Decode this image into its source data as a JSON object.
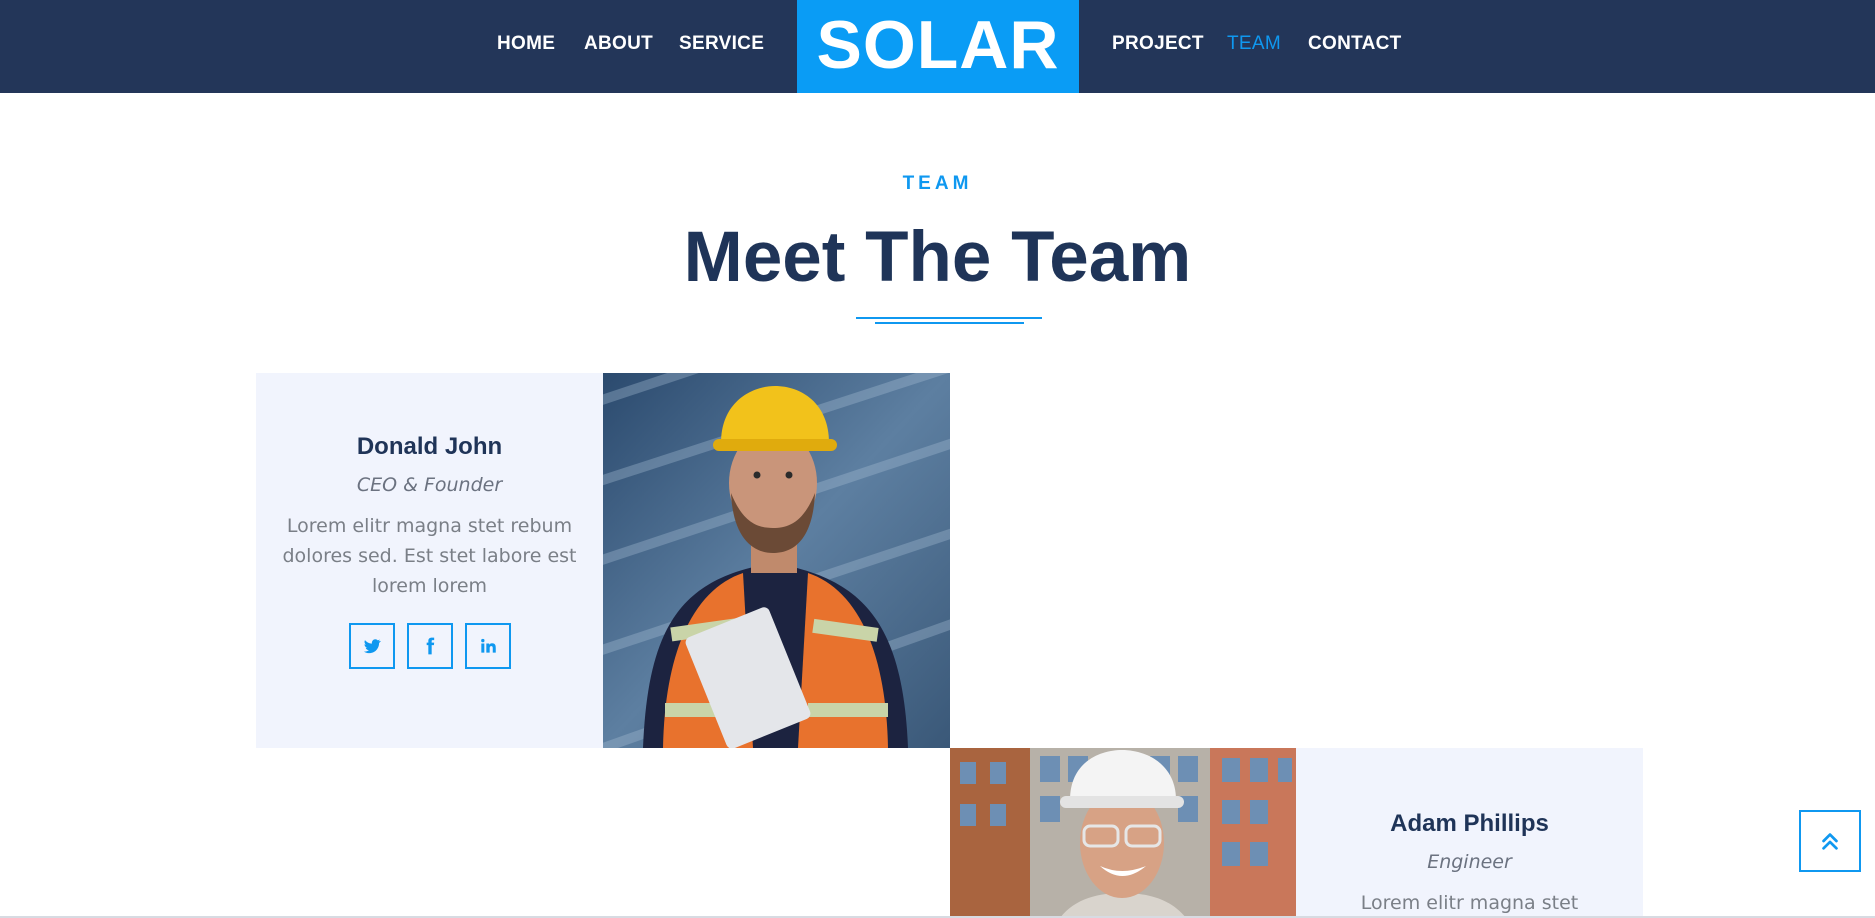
{
  "nav": {
    "left_links": [
      "HOME",
      "ABOUT",
      "SERVICE"
    ],
    "brand": "SOLAR",
    "right_links": [
      "PROJECT",
      "TEAM",
      "CONTACT"
    ],
    "active": "TEAM",
    "colors": {
      "bar": "#233659",
      "brand_bg": "#0a9cf5",
      "active": "#0f98f0"
    }
  },
  "section": {
    "kicker": "TEAM",
    "title": "Meet The Team"
  },
  "team": [
    {
      "name": "Donald John",
      "role": "CEO & Founder",
      "bio": "Lorem elitr magna stet rebum dolores sed. Est stet labore est lorem lorem",
      "socials": [
        "twitter-icon",
        "facebook-icon",
        "linkedin-icon"
      ]
    },
    {
      "name": "Adam Phillips",
      "role": "Engineer",
      "bio": "Lorem elitr magna stet"
    }
  ],
  "back_to_top_icon": "double-chevron-up-icon"
}
